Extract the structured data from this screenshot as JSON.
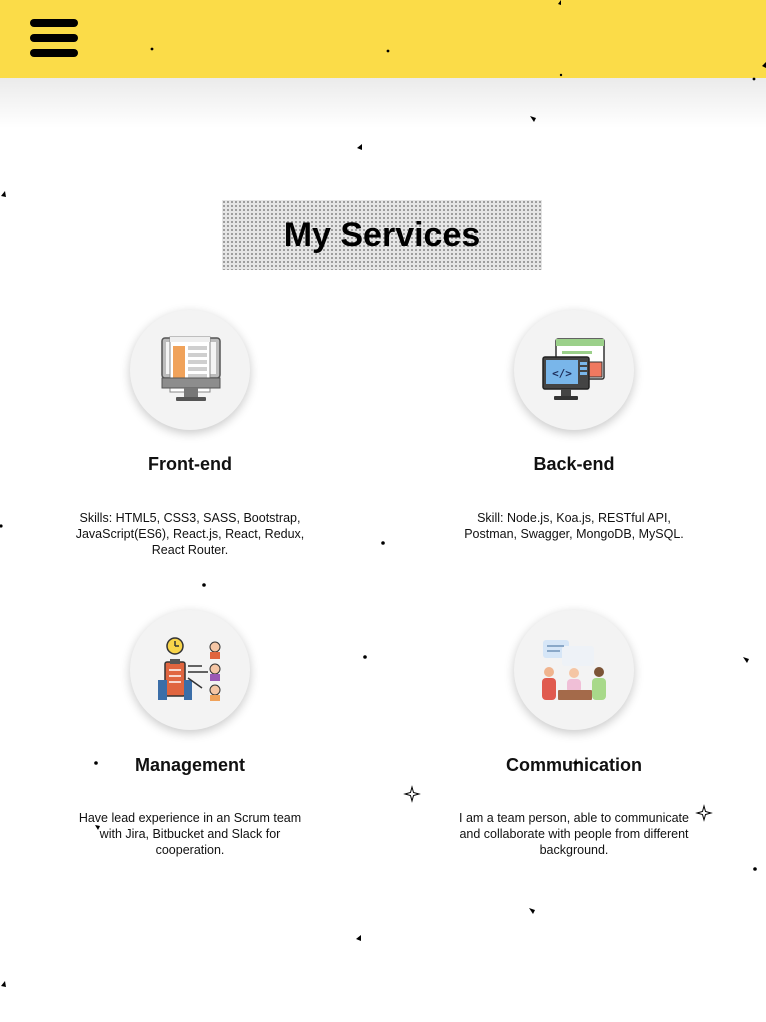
{
  "header": {
    "menu_icon": "hamburger-menu-icon",
    "background_color": "#fbdc48"
  },
  "section": {
    "title": "My Services"
  },
  "services": [
    {
      "title": "Front-end",
      "description": "Skills: HTML5, CSS3, SASS, Bootstrap, JavaScript(ES6), React.js, React,    Redux, React Router.",
      "icon": "monitor-webpage-icon"
    },
    {
      "title": "Back-end",
      "description": "Skill: Node.js, Koa.js, RESTful API, Postman, Swagger, MongoDB, MySQL.",
      "icon": "code-screen-icon"
    },
    {
      "title": "Management",
      "description": "Have lead experience in an Scrum team with Jira, Bitbucket and Slack for cooperation.",
      "icon": "team-task-management-icon"
    },
    {
      "title": "Communication",
      "description": "I am a team person, able to communicate and collaborate with people from different background.",
      "icon": "people-discussion-icon"
    }
  ]
}
